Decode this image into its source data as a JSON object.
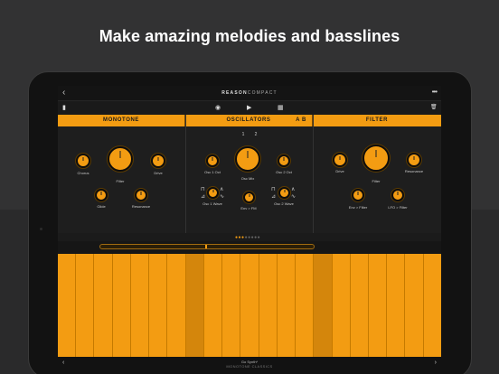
{
  "headline": "Make amazing melodies and basslines",
  "app": {
    "brand_main": "REASON",
    "brand_sub": "COMPACT",
    "back_icon": "‹",
    "more_icon": "•••"
  },
  "toolbar": {
    "left_icon": "▮",
    "record_icon": "◉",
    "play_icon": "▶",
    "grid_icon": "▦",
    "trash_icon": "🗑"
  },
  "sections": {
    "monotone": "MONOTONE",
    "oscillators": "OSCILLATORS",
    "osc_ab": "A B",
    "filter": "FILTER"
  },
  "monotone": {
    "chorus": "Chorus",
    "filter": "Filter",
    "drive": "Drive",
    "glide": "Glide",
    "resonance": "Resonance"
  },
  "oscillators": {
    "num1": "1",
    "num2": "2",
    "osc1_oct": "Osc 1 Oct",
    "osc_mix": "Osc Mix",
    "osc2_oct": "Osc 2 Oct",
    "osc1_wave": "Osc 1 Wave",
    "env_fm": "Env > FM",
    "osc2_wave": "Osc 2 Wave"
  },
  "filter_panel": {
    "drive": "Drive",
    "filter": "Filter",
    "resonance": "Resonance",
    "env_filter": "Env > Filter",
    "lfo_filter": "LFO > Filter"
  },
  "pager": {
    "on": "●●●",
    "off": "●●●●●"
  },
  "bottom": {
    "patch_name": "Go Synth*",
    "patch_sub": "MONOTONE CLASSICS",
    "prev_icon": "‹",
    "next_icon": "›"
  },
  "colors": {
    "accent": "#f39c12",
    "background": "#323233"
  }
}
